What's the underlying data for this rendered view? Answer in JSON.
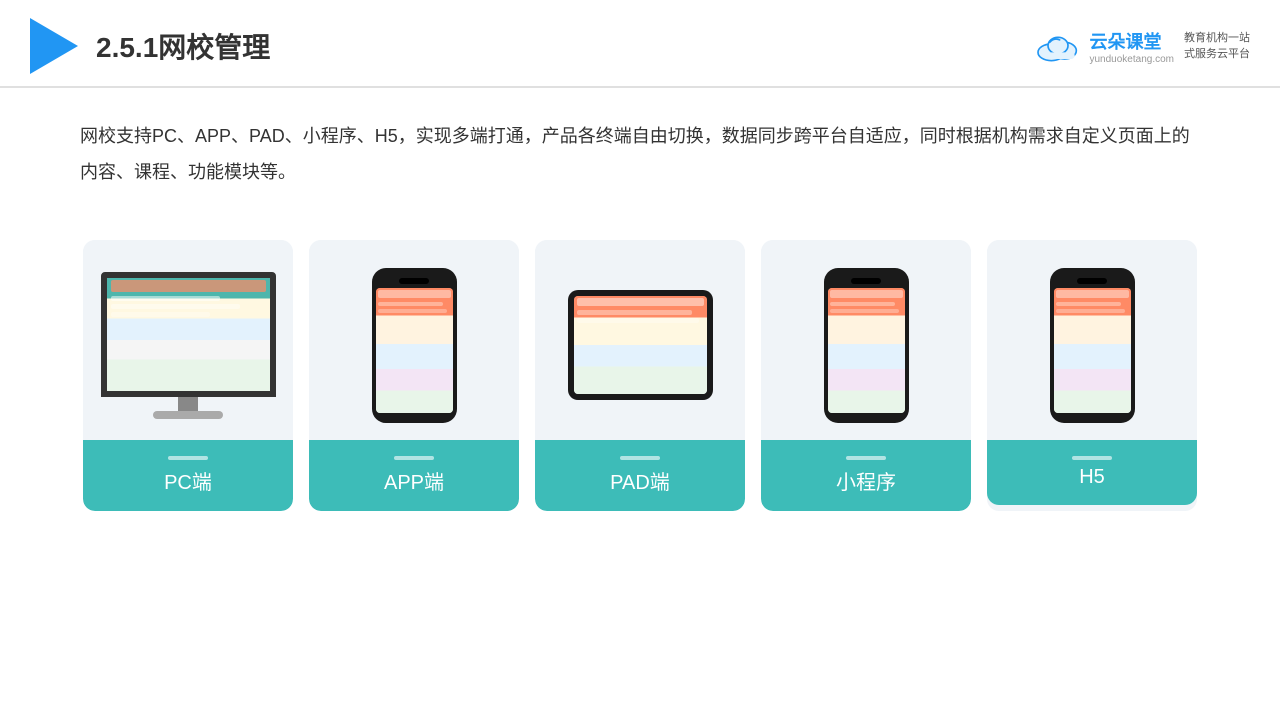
{
  "header": {
    "title": "2.5.1网校管理",
    "brand": {
      "name": "云朵课堂",
      "url": "yunduoketang.com",
      "slogan": "教育机构一站\n式服务云平台"
    }
  },
  "description": {
    "text": "网校支持PC、APP、PAD、小程序、H5，实现多端打通，产品各终端自由切换，数据同步跨平台自适应，同时根据机构需求自定义页面上的内容、课程、功能模块等。"
  },
  "cards": [
    {
      "id": "pc",
      "label": "PC端",
      "device": "monitor"
    },
    {
      "id": "app",
      "label": "APP端",
      "device": "phone"
    },
    {
      "id": "pad",
      "label": "PAD端",
      "device": "tablet"
    },
    {
      "id": "miniprogram",
      "label": "小程序",
      "device": "phone-mini"
    },
    {
      "id": "h5",
      "label": "H5",
      "device": "phone-mini2"
    }
  ],
  "colors": {
    "accent": "#3dbcb8",
    "headerBorder": "#e0e0e0",
    "triangleBlue": "#2196F3",
    "cardBg": "#f0f4f8"
  }
}
